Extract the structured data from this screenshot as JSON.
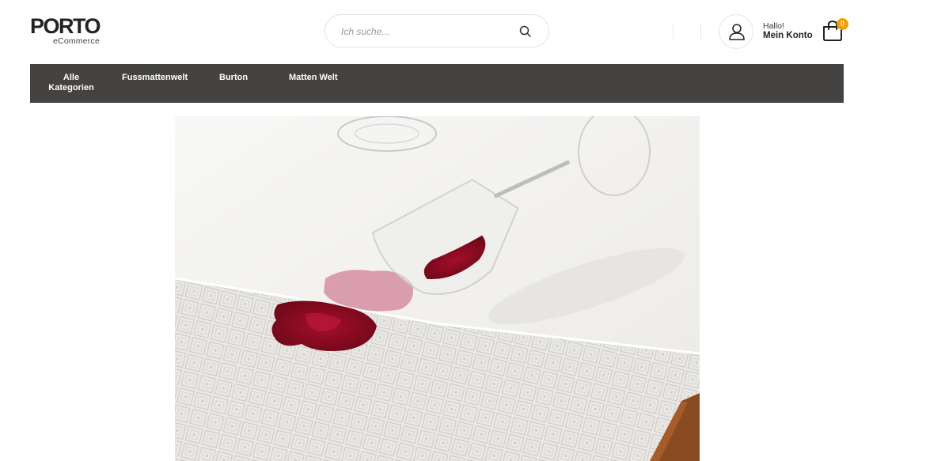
{
  "header": {
    "logo_text": "PORTO",
    "logo_subtext": "eCommerce",
    "search_placeholder": "Ich suche...",
    "account_greeting": "Hallo!",
    "account_label": "Mein Konto",
    "cart_count": "0"
  },
  "nav": {
    "items": [
      {
        "label_line1": "Alle",
        "label_line2": "Kategorien"
      },
      {
        "label": "Fussmattenwelt"
      },
      {
        "label": "Burton"
      },
      {
        "label": "Matten Welt"
      }
    ]
  },
  "colors": {
    "nav_background": "#454341",
    "cart_badge": "#f0a000"
  },
  "icons": [
    "search-icon",
    "user-icon",
    "shopping-bag-icon"
  ],
  "hero": {
    "image": "red wine spilled from a glass onto white tablecloth and patterned mat"
  }
}
